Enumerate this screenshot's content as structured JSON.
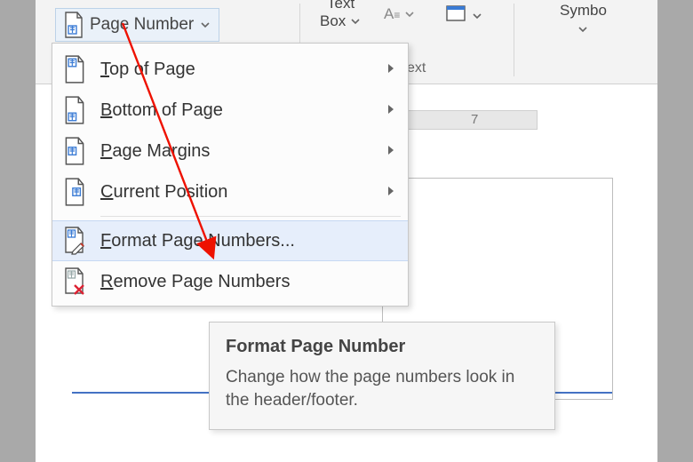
{
  "ribbon": {
    "page_number_label": "Page Number",
    "text_box_top": "Text",
    "text_box_bottom": "Box",
    "text_group_label": "ext",
    "symbol_label": "Symbo"
  },
  "ruler": {
    "tick": "7"
  },
  "menu": {
    "items": [
      {
        "label": "Top of Page",
        "ukey": "T",
        "submenu": true
      },
      {
        "label": "Bottom of Page",
        "ukey": "B",
        "submenu": true
      },
      {
        "label": "Page Margins",
        "ukey": "P",
        "submenu": true
      },
      {
        "label": "Current Position",
        "ukey": "C",
        "submenu": true
      },
      {
        "label": "Format Page Numbers...",
        "ukey": "F",
        "submenu": false,
        "highlight": true
      },
      {
        "label": "Remove Page Numbers",
        "ukey": "R",
        "submenu": false
      }
    ]
  },
  "tooltip": {
    "title": "Format Page Number",
    "body": "Change how the page numbers look in the header/footer."
  }
}
